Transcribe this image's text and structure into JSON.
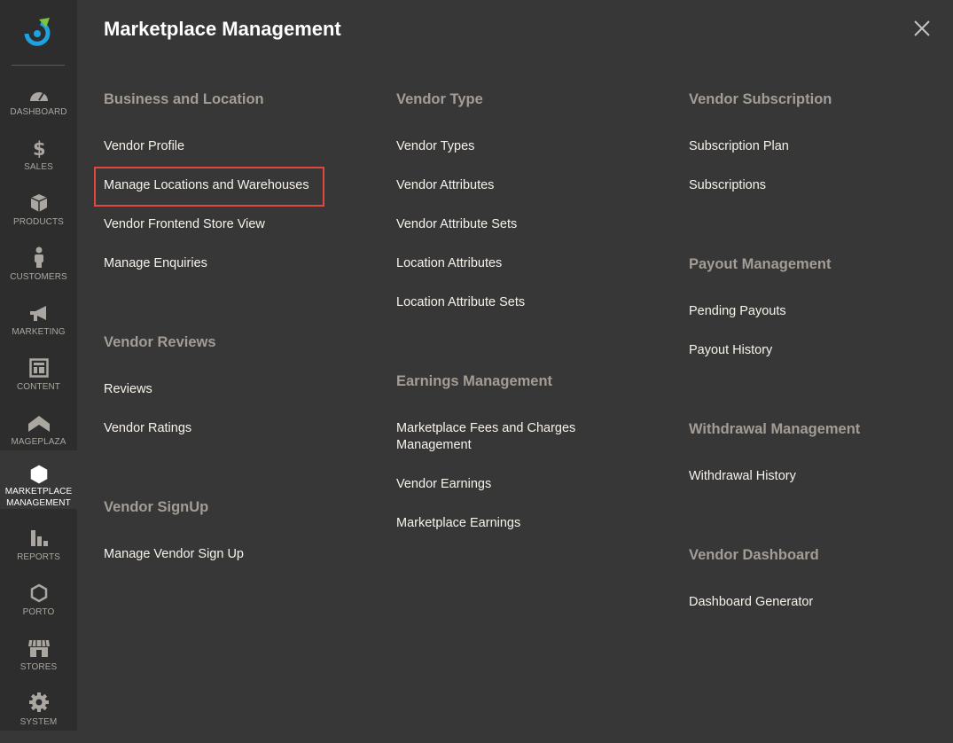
{
  "sidebar": {
    "items": [
      {
        "label": "DASHBOARD",
        "icon": "dashboard-icon"
      },
      {
        "label": "SALES",
        "icon": "dollar-icon"
      },
      {
        "label": "PRODUCTS",
        "icon": "box-icon"
      },
      {
        "label": "CUSTOMERS",
        "icon": "person-icon"
      },
      {
        "label": "MARKETING",
        "icon": "megaphone-icon"
      },
      {
        "label": "CONTENT",
        "icon": "layout-icon"
      },
      {
        "label": "MAGEPLAZA",
        "icon": "mageplaza-icon"
      },
      {
        "label_line1": "MARKETPLACE",
        "label_line2": "MANAGEMENT",
        "icon": "hexagon-icon",
        "active": true
      },
      {
        "label": "REPORTS",
        "icon": "bar-chart-icon"
      },
      {
        "label": "PORTO",
        "icon": "hexagon-icon"
      },
      {
        "label": "STORES",
        "icon": "storefront-icon"
      },
      {
        "label": "SYSTEM",
        "icon": "gear-icon"
      }
    ]
  },
  "panel": {
    "title": "Marketplace Management",
    "columns": [
      {
        "sections": [
          {
            "title": "Business and Location",
            "links": [
              "Vendor Profile",
              "Manage Locations and Warehouses",
              "Vendor Frontend Store View",
              "Manage Enquiries"
            ]
          },
          {
            "title": "Vendor Reviews",
            "links": [
              "Reviews",
              "Vendor Ratings"
            ]
          },
          {
            "title": "Vendor SignUp",
            "links": [
              "Manage Vendor Sign Up"
            ]
          }
        ]
      },
      {
        "sections": [
          {
            "title": "Vendor Type",
            "links": [
              "Vendor Types",
              "Vendor Attributes",
              "Vendor Attribute Sets",
              "Location Attributes",
              "Location Attribute Sets"
            ]
          },
          {
            "title": "Earnings Management",
            "links": [
              "Marketplace Fees and Charges Management",
              "Vendor Earnings",
              "Marketplace Earnings"
            ]
          }
        ]
      },
      {
        "sections": [
          {
            "title": "Vendor Subscription",
            "links": [
              "Subscription Plan",
              "Subscriptions"
            ]
          },
          {
            "title": "Payout Management",
            "links": [
              "Pending Payouts",
              "Payout History"
            ]
          },
          {
            "title": "Withdrawal Management",
            "links": [
              "Withdrawal History"
            ]
          },
          {
            "title": "Vendor Dashboard",
            "links": [
              "Dashboard Generator"
            ]
          }
        ]
      }
    ]
  },
  "colors": {
    "sidebar_bg": "#2d2d2d",
    "panel_bg": "#373737",
    "section_title": "#a39d95",
    "link": "#f7f3eb",
    "highlight_border": "#e0483e",
    "logo_accent": "#1ea1e0"
  }
}
